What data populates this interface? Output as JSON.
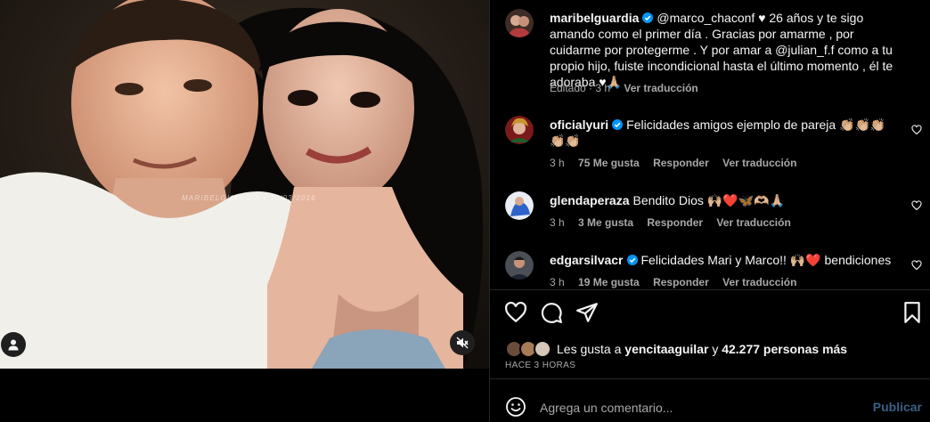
{
  "media": {
    "watermark": "MARIBELGUARDIA • 10/03/2016",
    "user_tag_icon": "user-icon",
    "mute_icon": "muted-speaker-icon"
  },
  "caption": {
    "username": "maribelguardia",
    "verified": true,
    "text": "@marco_chaconf ♥ 26 años y te sigo amando como el primer día . Gracias por amarme , por cuidarme por protegerme . Y por amar a @julian_f.f como a tu propio hijo, fuiste incondicional hasta el último momento , él te adoraba ♥🙏🏼",
    "edited": "Editado · 3 h",
    "translate": "Ver traducción"
  },
  "comments": [
    {
      "username": "oficialyuri",
      "verified": true,
      "text": "Felicidades amigos ejemplo de pareja 👏🏼👏🏼👏🏼👏🏼👏🏼",
      "time": "3 h",
      "likes": "75 Me gusta",
      "reply": "Responder",
      "translate": "Ver traducción"
    },
    {
      "username": "glendaperaza",
      "verified": false,
      "text": "Bendito Dios 🙌🏼❤️🦋🫶🏼🙏🏼",
      "time": "3 h",
      "likes": "3 Me gusta",
      "reply": "Responder",
      "translate": "Ver traducción"
    },
    {
      "username": "edgarsilvacr",
      "verified": true,
      "text": "Felicidades Mari y Marco!! 🙌🏼❤️ bendiciones",
      "time": "3 h",
      "likes": "19 Me gusta",
      "reply": "Responder",
      "translate": "Ver traducción"
    }
  ],
  "actions": {
    "like_icon": "heart-icon",
    "comment_icon": "comment-icon",
    "share_icon": "paper-plane-icon",
    "save_icon": "bookmark-icon"
  },
  "likes": {
    "prefix": "Les gusta a",
    "user": "yencitaaguilar",
    "middle": "y",
    "count": "42.277 personas más"
  },
  "posted": "HACE 3 HORAS",
  "composer": {
    "placeholder": "Agrega un comentario...",
    "publish": "Publicar",
    "emoji_icon": "smiley-icon"
  },
  "colors": {
    "background": "#000000",
    "text": "#f5f5f5",
    "secondary": "#a8a8a8",
    "verified": "#0095f6",
    "publish_disabled": "#3a5f86",
    "divider": "#262626"
  }
}
